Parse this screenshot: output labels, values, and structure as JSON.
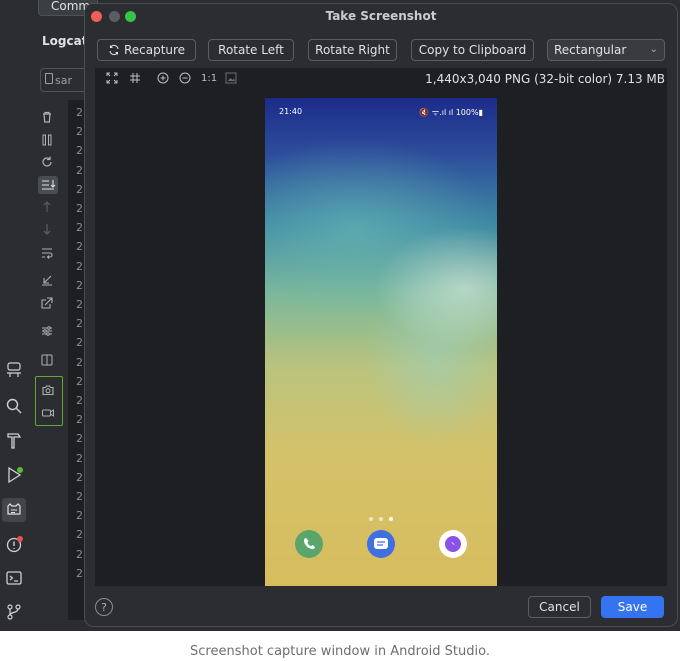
{
  "ide": {
    "tab_label": "Comm",
    "panel_title": "Logcat",
    "filter_text": "sar",
    "log_prefix": "2",
    "log_line_count": 25
  },
  "dialog": {
    "title": "Take Screenshot",
    "buttons": {
      "recapture": "Recapture",
      "rotate_left": "Rotate Left",
      "rotate_right": "Rotate Right",
      "copy": "Copy to Clipboard"
    },
    "frame_select": "Rectangular",
    "zoom_1to1": "1:1",
    "image_info": "1,440x3,040 PNG (32-bit color) 7.13 MB",
    "help": "?",
    "cancel": "Cancel",
    "save": "Save"
  },
  "phone": {
    "time": "21:40",
    "status_right": "🔇 ᯤ.ıl ıl 100%▮",
    "page_dots": 3,
    "active_page": 2,
    "apps": [
      "phone-app",
      "messages-app",
      "messenger-app"
    ]
  },
  "colors": {
    "ide_bg": "#2b2d30",
    "accent": "#3574f0",
    "highlight_box": "#5fa83a"
  },
  "caption": "Screenshot capture window in Android Studio."
}
